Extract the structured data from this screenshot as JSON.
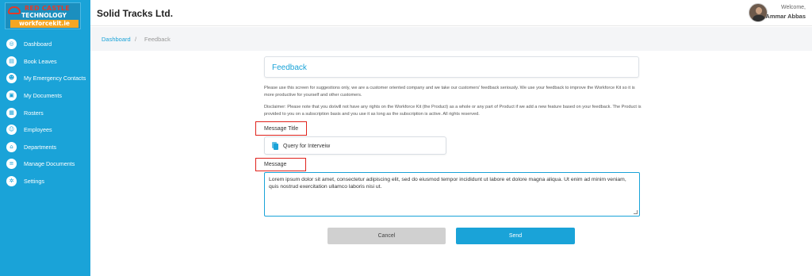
{
  "brand": {
    "line1": "RED CASTLE",
    "line2": "TECHNOLOGY",
    "line3": "workforcekit.ie"
  },
  "sidebar": {
    "items": [
      {
        "label": "Dashboard",
        "icon": "dashboard-icon",
        "glyph": "◎"
      },
      {
        "label": "Book Leaves",
        "icon": "calendar-icon",
        "glyph": "▤"
      },
      {
        "label": "My Emergency Contacts",
        "icon": "contact-icon",
        "glyph": "☻"
      },
      {
        "label": "My Documents",
        "icon": "document-icon",
        "glyph": "▣"
      },
      {
        "label": "Rosters",
        "icon": "roster-icon",
        "glyph": "▦"
      },
      {
        "label": "Employees",
        "icon": "employees-icon",
        "glyph": "☺"
      },
      {
        "label": "Departments",
        "icon": "departments-icon",
        "glyph": "⌂"
      },
      {
        "label": "Manage Documents",
        "icon": "manage-documents-icon",
        "glyph": "≡"
      },
      {
        "label": "Settings",
        "icon": "settings-icon",
        "glyph": "✲"
      }
    ]
  },
  "header": {
    "company": "Solid Tracks Ltd.",
    "welcome": "Welcome,",
    "user": "Ammar Abbas"
  },
  "breadcrumb": {
    "home": "Dashboard",
    "separator": "/",
    "current": "Feedback"
  },
  "feedback": {
    "title": "Feedback",
    "intro": "Please use this screen for suggestions only, we are a customer oriented company and we take our customers' feedback seriously. We use your feedback to improve the Workforce Kit so it is more productive for yourself and other customers.",
    "disclaimer": "Disclaimer: Please note that you do/will not have any rights on the Workforce Kit (the Product) as a whole or any part of Product if we add a new feature based on your feedback. The Product is provided to you on a subscription basis and you use it as long as the subscription is active. All rights reserved.",
    "message_title_label": "Message Title",
    "message_title_value": "Query for Interveiw",
    "message_label": "Message",
    "message_value": "Lorem ipsum dolor sit amet, consectetur adipiscing elit, sed do eiusmod tempor incididunt ut labore et dolore magna aliqua. Ut enim ad minim veniam, quis nostrud exercitation ullamco laboris nisi ut.",
    "cancel_label": "Cancel",
    "send_label": "Send"
  },
  "colors": {
    "accent": "#1aa3d8",
    "highlight": "#e0221b",
    "cancel_bg": "#d0d0d0"
  }
}
